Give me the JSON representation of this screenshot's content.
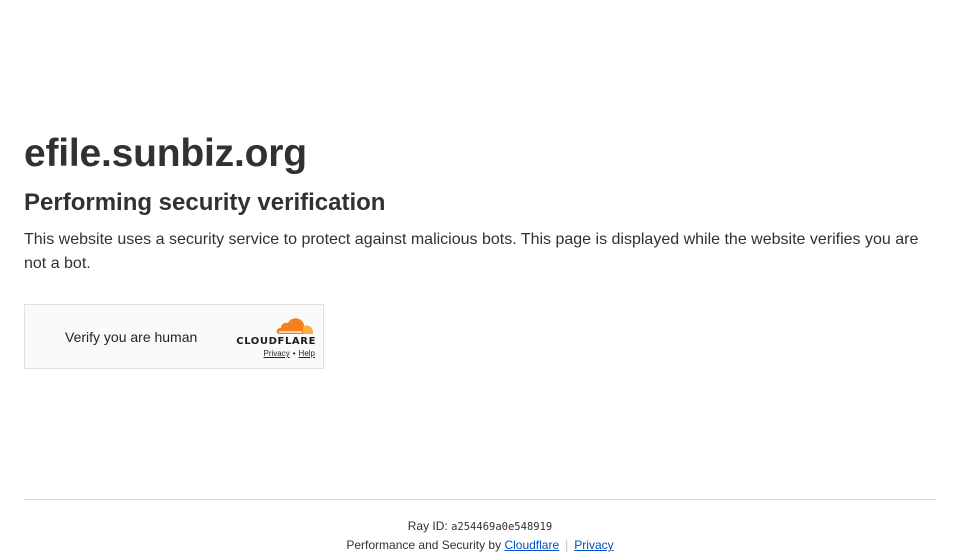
{
  "header": {
    "site_title": "efile.sunbiz.org",
    "subtitle": "Performing security verification",
    "description": "This website uses a security service to protect against malicious bots. This page is displayed while the website verifies you are not a bot."
  },
  "widget": {
    "label": "Verify you are human",
    "brand": "CLOUDFLARE",
    "privacy_link": "Privacy",
    "link_separator": "•",
    "help_link": "Help"
  },
  "footer": {
    "ray_id_label": "Ray ID:",
    "ray_id_value": "a254469a0e548919",
    "performance_text": "Performance and Security by",
    "cloudflare_link": "Cloudflare",
    "separator": "|",
    "privacy_link": "Privacy"
  },
  "colors": {
    "text": "#313131",
    "link": "#0051c3",
    "cloudflare_orange": "#f38020",
    "cloudflare_orange_light": "#faae40",
    "widget_border": "#e0e0e0"
  }
}
